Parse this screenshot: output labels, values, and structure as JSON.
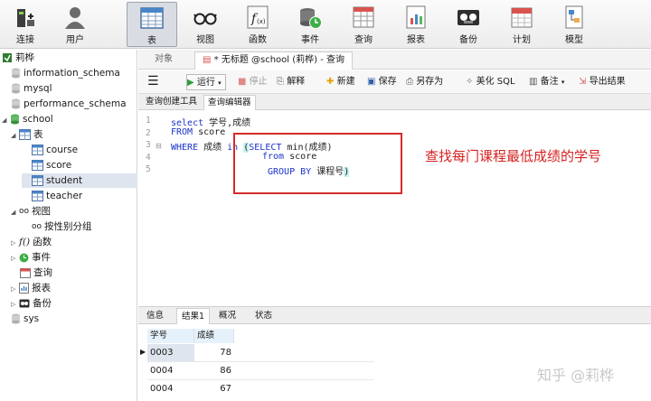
{
  "toolbar": {
    "items": [
      {
        "label": "连接",
        "icon": "connection-icon"
      },
      {
        "label": "用户",
        "icon": "user-icon"
      },
      {
        "label": "表",
        "icon": "table-icon",
        "active": true
      },
      {
        "label": "视图",
        "icon": "view-glasses-icon"
      },
      {
        "label": "函数",
        "icon": "function-icon"
      },
      {
        "label": "事件",
        "icon": "event-clock-icon"
      },
      {
        "label": "查询",
        "icon": "query-icon"
      },
      {
        "label": "报表",
        "icon": "report-icon"
      },
      {
        "label": "备份",
        "icon": "backup-icon"
      },
      {
        "label": "计划",
        "icon": "calendar-icon"
      },
      {
        "label": "模型",
        "icon": "model-icon"
      }
    ]
  },
  "tree": {
    "connection": "莉桦",
    "databases": [
      "information_schema",
      "mysql",
      "performance_schema",
      "school"
    ],
    "tables_label": "表",
    "tables": [
      "course",
      "score",
      "student",
      "teacher"
    ],
    "selected_table": "student",
    "views_label": "视图",
    "view_item": "按性别分组",
    "functions_label": "函数",
    "events_label": "事件",
    "queries_label": "查询",
    "reports_label": "报表",
    "backups_label": "备份",
    "sys_db": "sys"
  },
  "tabs": {
    "objects": "对象",
    "query": "* 无标题 @school (莉桦) - 查询"
  },
  "query_toolbar": {
    "run": "运行",
    "stop": "停止",
    "explain": "解释",
    "new": "新建",
    "save": "保存",
    "save_as": "另存为",
    "beautify": "美化 SQL",
    "comment": "备注",
    "export": "导出结果"
  },
  "subtabs": {
    "builder": "查询创建工具",
    "editor": "查询编辑器"
  },
  "editor": {
    "line_numbers": [
      "1",
      "2",
      "3",
      "4",
      "5"
    ],
    "l1_kw": "select",
    "l1_rest": " 学号,成绩",
    "l2_kw": "FROM",
    "l2_rest": " score",
    "l3_kw1": "WHERE",
    "l3_mid": " 成绩 ",
    "l3_kw2": "in",
    "l3_open": "(",
    "l3_kw3": "SELECT",
    "l3_rest": " min(成绩)",
    "l4_kw": "from",
    "l4_rest": " score",
    "l5_kw": "GROUP BY",
    "l5_rest": " 课程号",
    "l5_close": ")",
    "annotation": "查找每门课程最低成绩的学号"
  },
  "result_tabs": [
    "信息",
    "结果1",
    "概况",
    "状态"
  ],
  "result": {
    "columns": [
      "学号",
      "成绩"
    ],
    "rows": [
      {
        "id": "0003",
        "score": "78"
      },
      {
        "id": "0004",
        "score": "86"
      },
      {
        "id": "0004",
        "score": "67"
      }
    ]
  },
  "watermark": "知乎 @莉桦",
  "colors": {
    "keyword": "#1a33c9",
    "annotation": "#d62020",
    "bracket_highlight": "#c7f3f3",
    "grid_header": "#e6f2fb"
  }
}
